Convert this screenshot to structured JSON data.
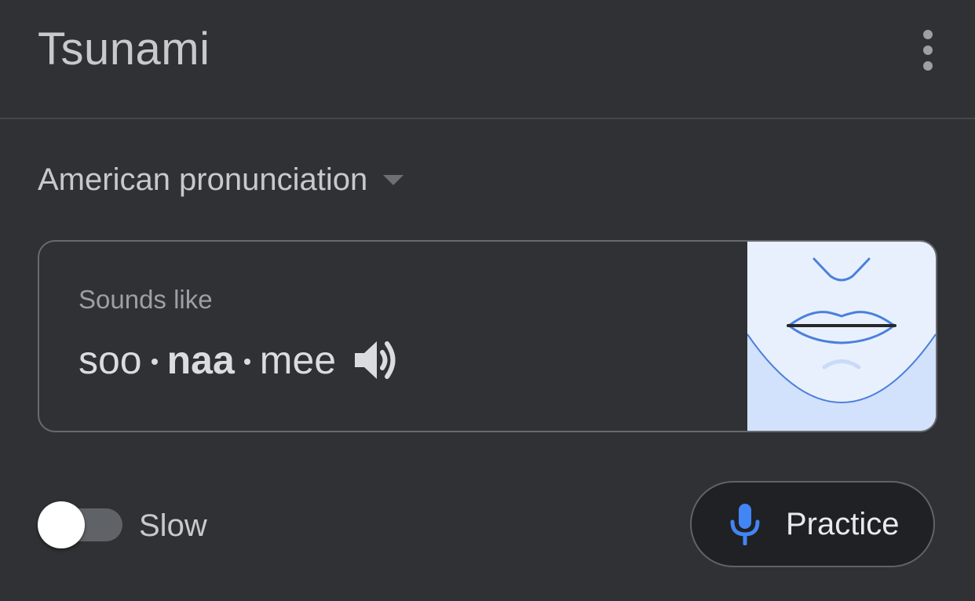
{
  "header": {
    "title": "Tsunami",
    "menu_icon": "more-vert-icon"
  },
  "accent": {
    "label": "American pronunciation",
    "caret_icon": "dropdown-caret-icon"
  },
  "pronunciation": {
    "sounds_like_label": "Sounds like",
    "syllables": [
      {
        "text": "soo",
        "stressed": false
      },
      {
        "text": "naa",
        "stressed": true
      },
      {
        "text": "mee",
        "stressed": false
      }
    ],
    "audio_icon": "speaker-icon",
    "illustration_icon": "mouth-shape-illustration"
  },
  "controls": {
    "slow_label": "Slow",
    "slow_enabled": false,
    "practice_label": "Practice",
    "practice_icon": "microphone-icon"
  },
  "colors": {
    "background": "#303134",
    "accent_blue": "#4285f4",
    "illustration_bg": "#e9f0fd",
    "illustration_fill": "#d2e2fc"
  }
}
